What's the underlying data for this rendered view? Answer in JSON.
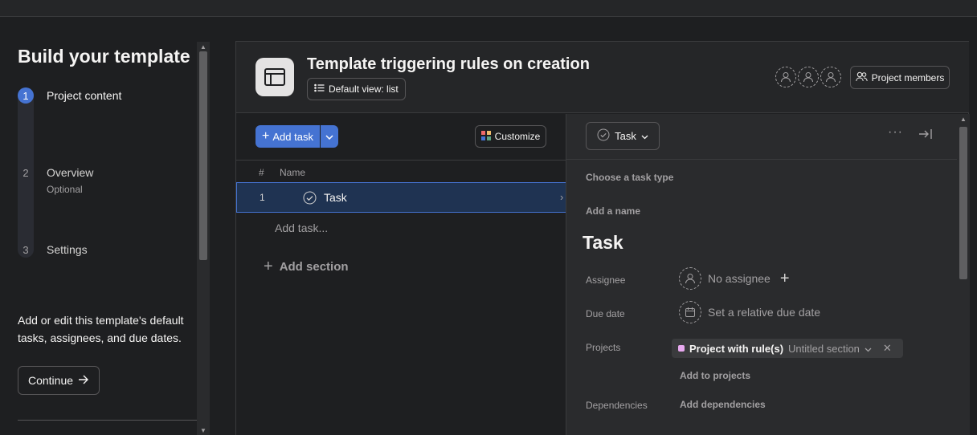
{
  "left": {
    "title": "Build your template",
    "steps": [
      {
        "num": "1",
        "label": "Project content",
        "sub": ""
      },
      {
        "num": "2",
        "label": "Overview",
        "sub": "Optional"
      },
      {
        "num": "3",
        "label": "Settings",
        "sub": ""
      }
    ],
    "description": "Add or edit this template's default tasks, assignees, and due dates.",
    "continue_label": "Continue"
  },
  "project": {
    "title": "Template triggering rules on creation",
    "view_label": "Default view: list",
    "members_label": "Project members"
  },
  "list": {
    "add_task_label": "Add task",
    "customize_label": "Customize",
    "col_hash": "#",
    "col_name": "Name",
    "rows": [
      {
        "num": "1",
        "name": "Task"
      }
    ],
    "add_task_inline": "Add task...",
    "add_section_label": "Add section"
  },
  "detail": {
    "type_label": "Task",
    "choose_type": "Choose a task type",
    "add_name": "Add a name",
    "task_title": "Task",
    "assignee_label": "Assignee",
    "assignee_value": "No assignee",
    "due_label": "Due date",
    "due_value": "Set a relative due date",
    "projects_label": "Projects",
    "project_name": "Project with rule(s)",
    "project_section": "Untitled section",
    "add_to_projects": "Add to projects",
    "dependencies_label": "Dependencies",
    "add_dependencies": "Add dependencies"
  },
  "colors": {
    "accent": "#4573d2",
    "project_dot": "#e8a9f0"
  }
}
